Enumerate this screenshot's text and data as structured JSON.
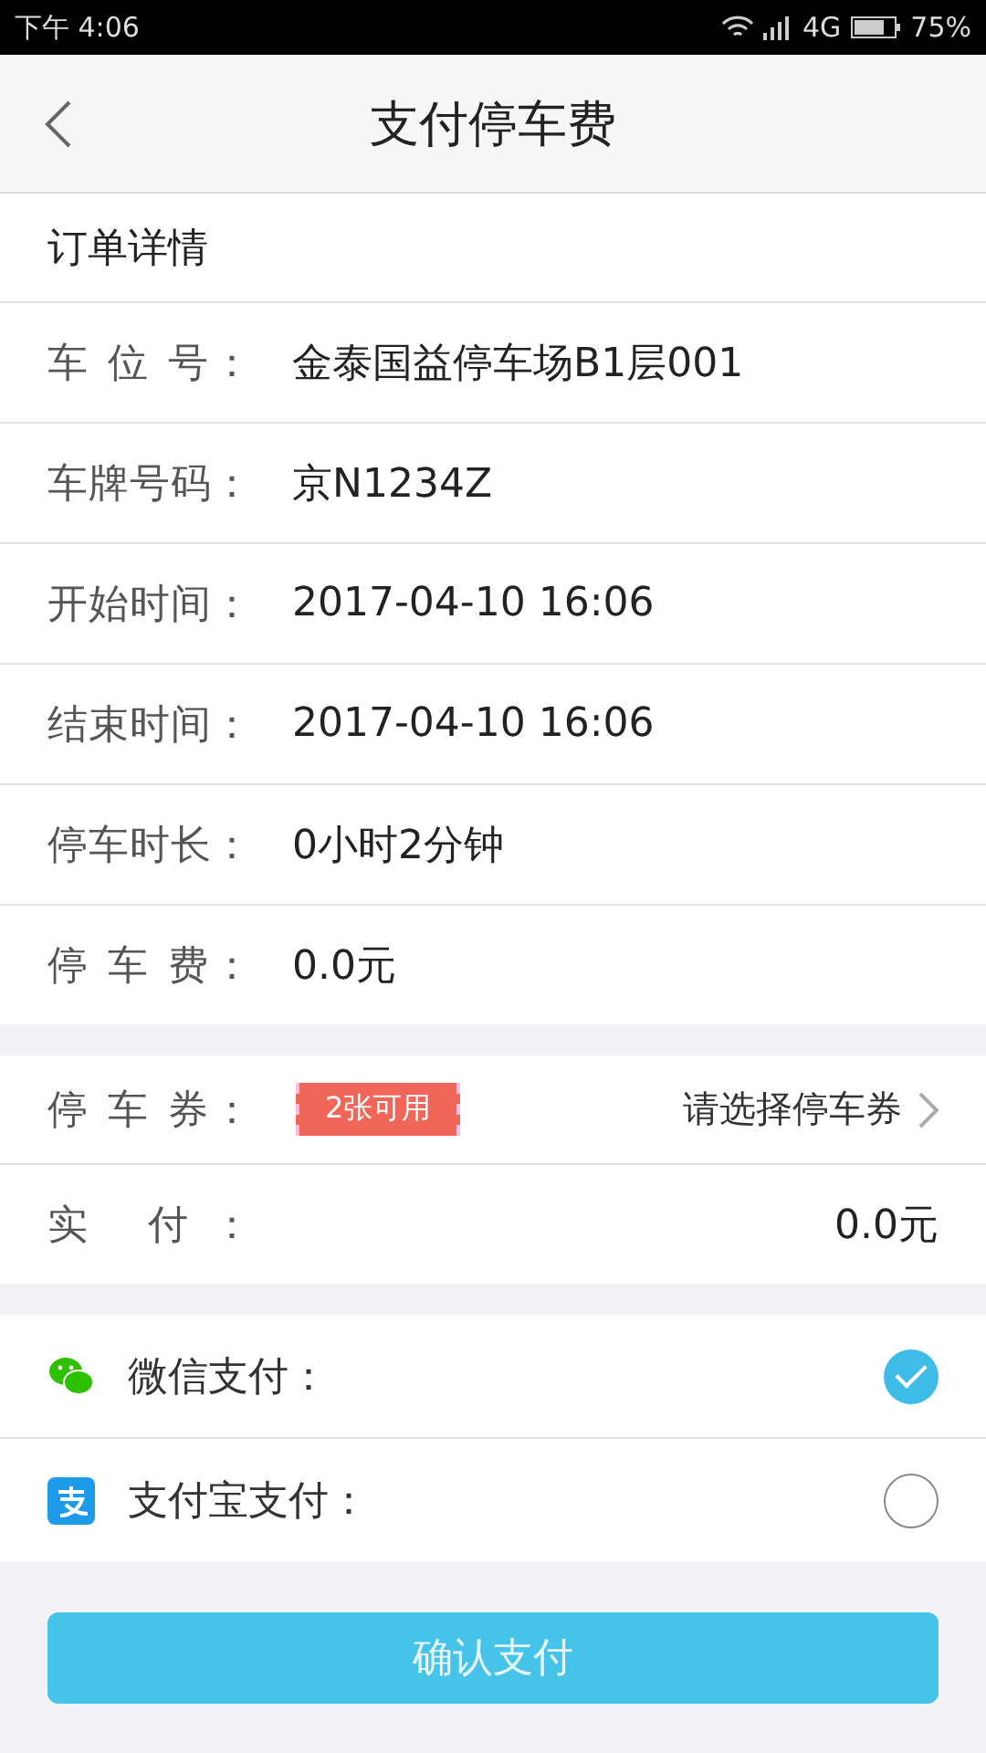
{
  "status_bar": {
    "time": "下午 4:06",
    "network": "4G",
    "battery": "75%"
  },
  "header": {
    "title": "支付停车费"
  },
  "order": {
    "title": "订单详情",
    "rows": [
      {
        "label": "车 位 号：",
        "value": "金泰国益停车场B1层001"
      },
      {
        "label": "车牌号码：",
        "value": "京N1234Z"
      },
      {
        "label": "开始时间：",
        "value": "2017-04-10 16:06"
      },
      {
        "label": "结束时间：",
        "value": "2017-04-10 16:06"
      },
      {
        "label": "停车时长：",
        "value": "0小时2分钟"
      },
      {
        "label": "停 车 费：",
        "value": "0.0元"
      }
    ]
  },
  "coupon": {
    "label": "停 车 券：",
    "badge": "2张可用",
    "action": "请选择停车券"
  },
  "paid": {
    "label": "实 付：",
    "value": "0.0元"
  },
  "payment_methods": [
    {
      "kind": "wechat",
      "label": "微信支付：",
      "selected": true
    },
    {
      "kind": "alipay",
      "label": "支付宝支付：",
      "selected": false
    }
  ],
  "confirm_button": "确认支付"
}
